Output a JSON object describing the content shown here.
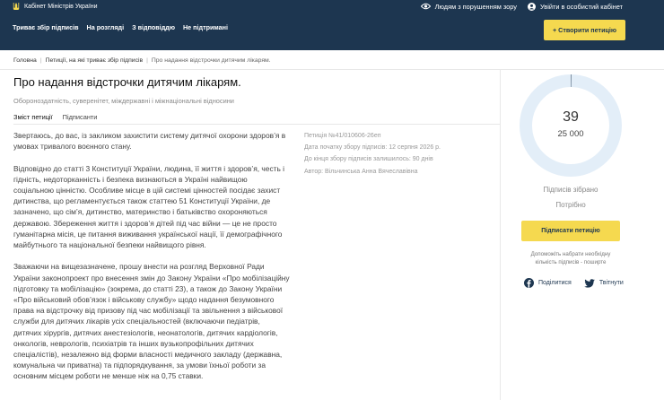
{
  "header": {
    "brand": "Кабінет Міністрів України",
    "links": [
      "Людям з порушенням зору",
      "Увійти в особистий кабінет"
    ],
    "nav": [
      "Триває збір підписів",
      "На розгляді",
      "З відповіддю",
      "Не підтримані"
    ],
    "create_button": "+ Створити петицію"
  },
  "breadcrumbs": [
    "Головна",
    "Петиції, на які триває збір підписів",
    "Про надання відстрочки дитячим лікарям."
  ],
  "petition": {
    "title": "Про надання відстрочки дитячим лікарям.",
    "topics": "Обороноздатність, суверенітет, міждержавні і міжнаціональні відносини",
    "tabs": [
      "Зміст петиції",
      "Підписанти"
    ],
    "paragraphs": [
      "Звертаюсь, до вас, із закликом захистити систему дитячої охорони здоров’я в умовах тривалого воєнного стану.",
      "Відповідно до статті 3 Конституції України, людина, її життя і здоров’я, честь і гідність, недоторканність і безпека визнаються в Україні найвищою соціальною цінністю. Особливе місце в цій системі цінностей посідає захист дитинства, що регламентується також статтею 51 Конституції України, де зазначено, що сім’я, дитинство, материнство і батьківство охороняються державою. Збереження життя і здоров’я дітей під час війни — це не просто гуманітарна місія, це питання виживання української нації, її демографічного майбутнього та національної безпеки найвищого рівня.",
      "Зважаючи на вищезазначене, прошу внести на розгляд Верховної Ради України законопроект про внесення змін до Закону України «Про мобілізаційну підготовку та мобілізацію» (зокрема, до статті 23), а також до Закону України «Про військовий обов’язок і військову службу» щодо надання безумовного права на відстрочку від призову під час мобілізації та звільнення з військової служби для дитячих лікарів усіх спеціальностей (включаючи педіатрів, дитячих хірургів, дитячих анестезіологів, неонатологів, дитячих кардіологів, онкологів, неврологів, психіатрів та інших вузькопрофільних дитячих спеціалістів), незалежно від форми власності медичного закладу (державна, комунальна чи приватна) та підпорядкування, за умови їхньої роботи за основним місцем роботи не менше ніж на 0,75 ставки."
    ],
    "meta": [
      "Петиція №41/010606-26еп",
      "Дата початку збору підписів: 12 серпня 2026 р.",
      "До кінця збору підписів залишилось: 90 днів",
      "Автор: Вільчинська Анна Вячеславівна"
    ]
  },
  "signatures": {
    "count": "39",
    "goal": "25 000",
    "progress": 0.00156,
    "collected_label": "Підписів зібрано",
    "needed_label": "Потрібно",
    "sign_button": "Підписати петицію",
    "help_text": "Допоможіть набрати необхідну кількість підписів - поширте",
    "share": [
      "Поділитися",
      "Твітнути"
    ]
  },
  "colors": {
    "header_bg": "#1d3650",
    "accent_yellow": "#f5d94f",
    "ring": "#e3eef8"
  }
}
